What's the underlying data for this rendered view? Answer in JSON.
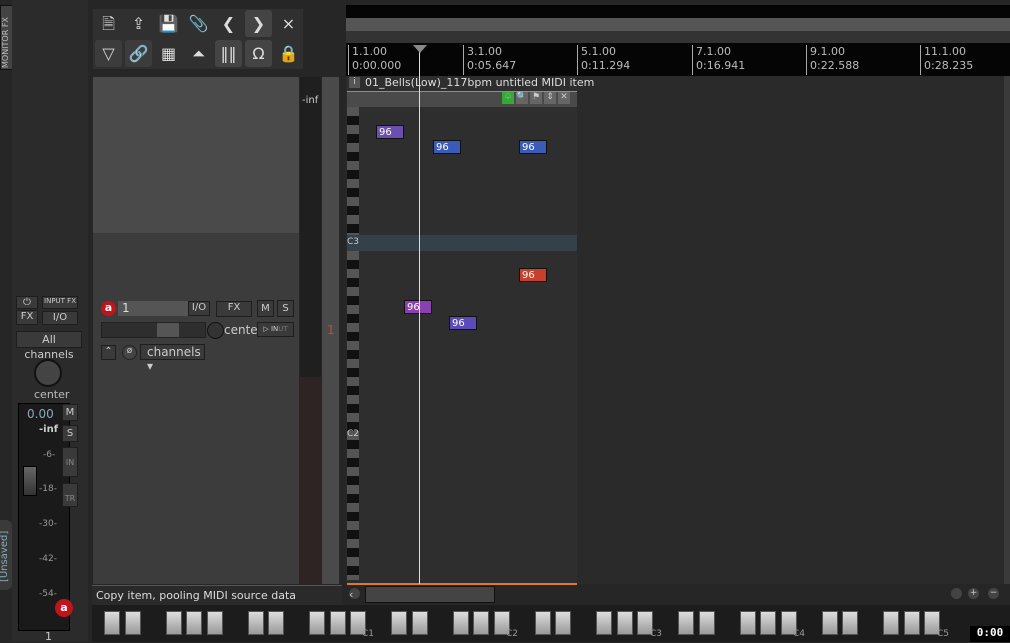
{
  "monitor_fx": "MONITOR FX",
  "master": {
    "input_fx": "INPUT FX",
    "fx": "FX",
    "io": "I/O",
    "channels": "All channels",
    "pan": "center",
    "volume": "0.00",
    "peak": "-inf",
    "mute": "M",
    "solo": "S",
    "in": "IN",
    "tr": "TR",
    "scale": [
      "-6-",
      "-18-",
      "-30-",
      "-42-",
      "-54-"
    ],
    "unsaved": "[Unsaved]",
    "track_num": "1"
  },
  "toolbar": {
    "icons": [
      "new-project-icon",
      "open-project-icon",
      "save-icon",
      "attach-icon",
      "back-icon",
      "forward-icon",
      "metronome-icon",
      "filter-icon",
      "link-icon",
      "grid-icon",
      "envelope-icon",
      "bars-icon",
      "snap-icon",
      "lock-icon"
    ]
  },
  "track": {
    "name": "1",
    "io": "I/O",
    "fx": "FX",
    "mute": "M",
    "solo": "S",
    "pan": "center",
    "in": "IN",
    "out": "UT",
    "channels": "channels",
    "peak": "-inf",
    "number": "1"
  },
  "ruler": [
    {
      "bar": "1.1.00",
      "time": "0:00.000"
    },
    {
      "bar": "3.1.00",
      "time": "0:05.647"
    },
    {
      "bar": "5.1.00",
      "time": "0:11.294"
    },
    {
      "bar": "7.1.00",
      "time": "0:16.941"
    },
    {
      "bar": "9.1.00",
      "time": "0:22.588"
    },
    {
      "bar": "11.1.00",
      "time": "0:28.235"
    }
  ],
  "item": {
    "title": "01_Bells(Low)_117bpm untitled MIDI item",
    "labels": [
      "C3",
      "C2"
    ],
    "notes": [
      "96",
      "96",
      "96",
      "96",
      "96",
      "96"
    ]
  },
  "colors": {
    "note_purple": "#6a4fb0",
    "note_blue": "#3b5bb8",
    "note_red": "#c8402c",
    "note_violet": "#8a40b0",
    "item_border": "#e07a1c"
  },
  "status": "Copy item, pooling MIDI source data",
  "keyboard": {
    "octaves": [
      "C1",
      "C2",
      "C3",
      "C4",
      "C5"
    ],
    "time": "0:00"
  }
}
